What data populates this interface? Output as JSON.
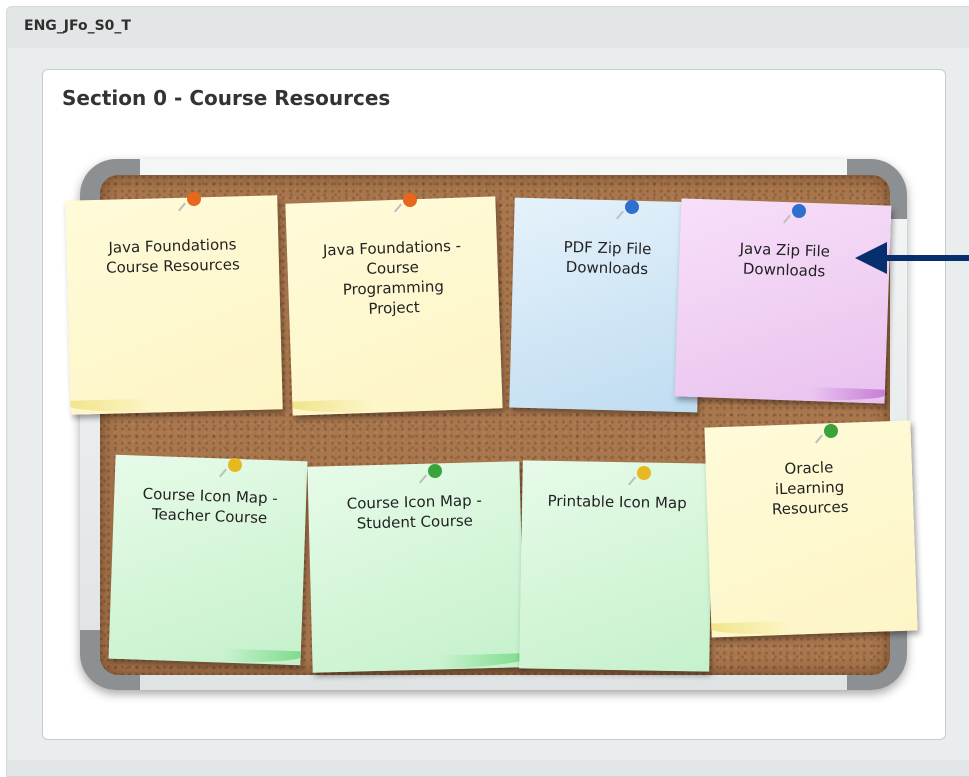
{
  "window": {
    "title": "ENG_JFo_S0_T"
  },
  "section": {
    "title": "Section 0 - Course Resources"
  },
  "notes": [
    {
      "label": "Java Foundations Course Resources",
      "color": "#fdf5c6",
      "pin": "#e8661d"
    },
    {
      "label": "Java Foundations - Course Programming Project",
      "color": "#fdf5c6",
      "pin": "#e8661d"
    },
    {
      "label": "PDF Zip File Downloads",
      "color": "#bfdcf1",
      "pin": "#2f6fd0"
    },
    {
      "label": "Java Zip File Downloads",
      "color": "#e9c2ef",
      "pin": "#2f6fd0"
    },
    {
      "label": "Course Icon Map - Teacher Course",
      "color": "#c5f1cc",
      "pin": "#e7b81f"
    },
    {
      "label": "Course Icon Map - Student Course",
      "color": "#c5f1cc",
      "pin": "#3aa33a"
    },
    {
      "label": "Printable Icon Map",
      "color": "#c5f1cc",
      "pin": "#e7b81f"
    },
    {
      "label": "Oracle iLearning Resources",
      "color": "#fdf5c6",
      "pin": "#3aa33a"
    }
  ],
  "annotation": {
    "arrow_color": "#082f6d",
    "icon": "arrow-left-icon"
  }
}
